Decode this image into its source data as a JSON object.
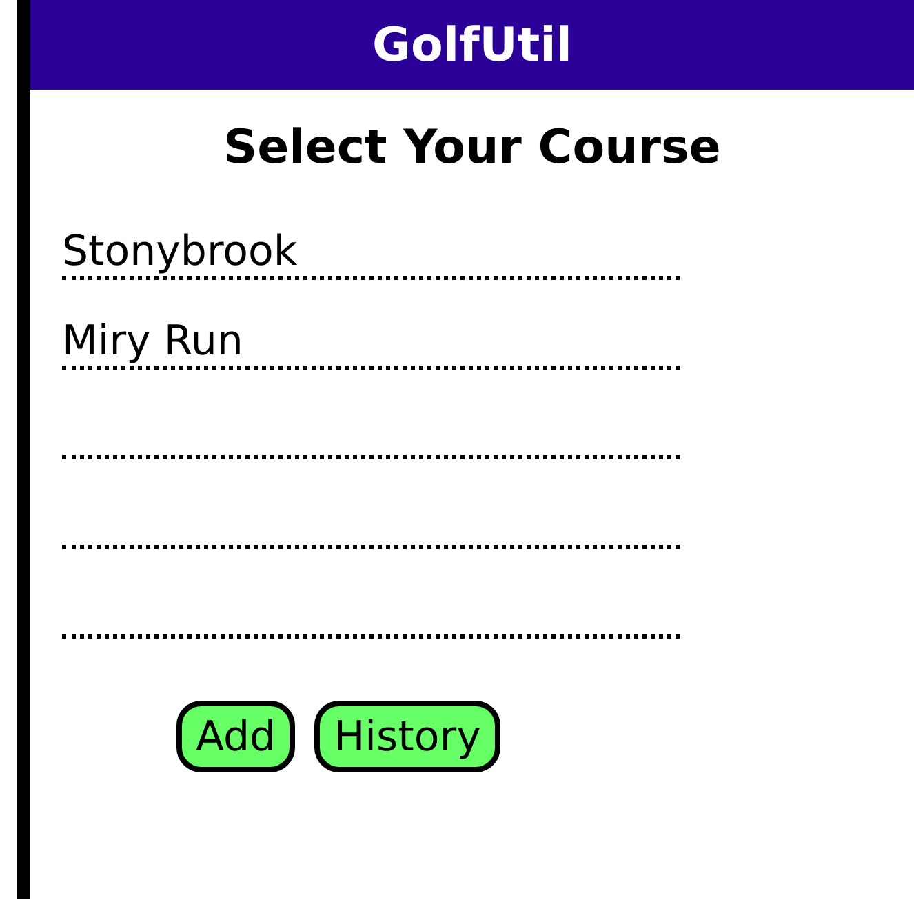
{
  "window": {
    "title": "GolfUtil"
  },
  "heading": "Select Your Course",
  "course_slots": [
    {
      "kind": "filled",
      "name": "Stonybrook"
    },
    {
      "kind": "filled",
      "name": "Miry Run"
    },
    {
      "kind": "blank"
    },
    {
      "kind": "blank"
    },
    {
      "kind": "blank"
    }
  ],
  "buttons": [
    "Add",
    "History"
  ]
}
